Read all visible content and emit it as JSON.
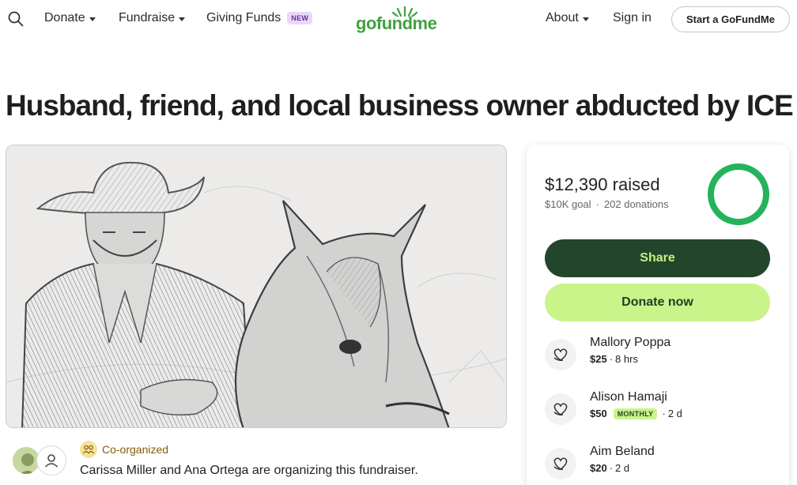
{
  "header": {
    "nav_left": [
      {
        "label": "Donate",
        "has_caret": true
      },
      {
        "label": "Fundraise",
        "has_caret": true
      },
      {
        "label": "Giving Funds",
        "badge": "NEW"
      }
    ],
    "logo_text": "gofundme",
    "nav_right": [
      {
        "label": "About",
        "has_caret": true
      },
      {
        "label": "Sign in"
      }
    ],
    "cta_label": "Start a GoFundMe"
  },
  "campaign": {
    "title": "Husband, friend, and local business owner abducted by ICE",
    "image_icon": "pencil-sketch-man-with-horse"
  },
  "organizers": {
    "badge_label": "Co-organized",
    "text": "Carissa Miller and Ana Ortega are organizing this fundraiser."
  },
  "donation_card": {
    "raised": "$12,390 raised",
    "goal": "$10K goal",
    "donations": "202 donations",
    "progress_fraction": 1.0,
    "share_label": "Share",
    "donate_label": "Donate now",
    "donors": [
      {
        "name": "Mallory Poppa",
        "amount": "$25",
        "time": "8 hrs",
        "monthly": ""
      },
      {
        "name": "Alison Hamaji",
        "amount": "$50",
        "time": "2 d",
        "monthly": "MONTHLY"
      },
      {
        "name": "Aim Beland",
        "amount": "$20",
        "time": "2 d",
        "monthly": ""
      }
    ]
  },
  "colors": {
    "brand_green": "#3fa241",
    "share_bg": "#23452c",
    "share_text": "#c9f07e",
    "donate_bg": "#c9f48a",
    "badge_new_bg": "#e9d9f6",
    "badge_new_text": "#6b2c9c"
  }
}
